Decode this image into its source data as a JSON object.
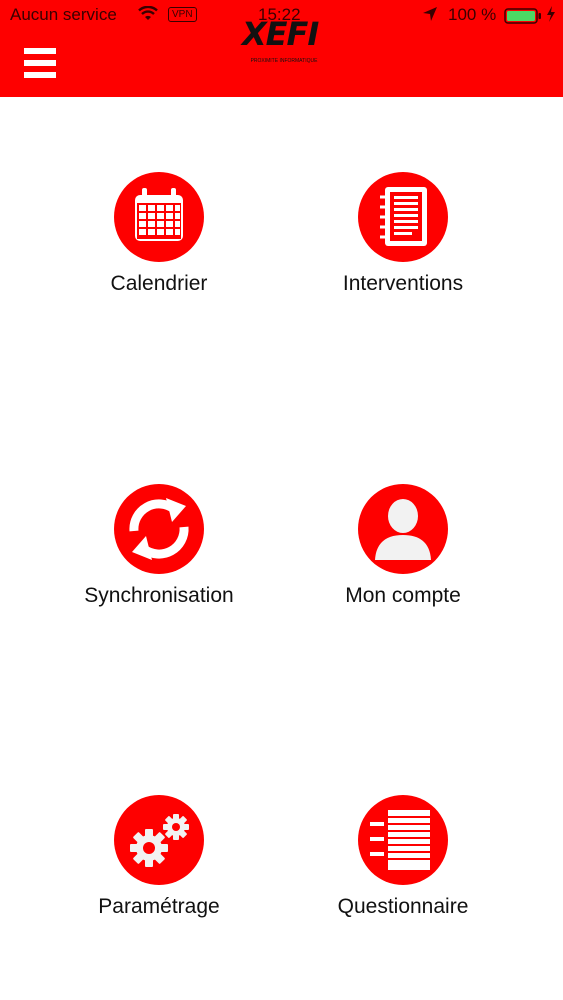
{
  "status_bar": {
    "carrier": "Aucun service",
    "vpn": "VPN",
    "time": "15:22",
    "battery_percent": "100 %",
    "icons": [
      "wifi-icon",
      "location-arrow-icon",
      "battery-icon",
      "charging-bolt-icon"
    ]
  },
  "header": {
    "logo_text": "XEFI",
    "logo_tagline": "PROXIMITE INFORMATIQUE",
    "menu_icon": "hamburger-menu-icon",
    "background": "#fe0000"
  },
  "tiles": [
    {
      "label": "Calendrier",
      "icon": "calendar-icon"
    },
    {
      "label": "Interventions",
      "icon": "notebook-icon"
    },
    {
      "label": "Synchronisation",
      "icon": "sync-icon"
    },
    {
      "label": "Mon compte",
      "icon": "user-icon"
    },
    {
      "label": "Paramétrage",
      "icon": "gears-icon"
    },
    {
      "label": "Questionnaire",
      "icon": "questionnaire-icon"
    }
  ],
  "colors": {
    "accent": "#fe0000",
    "text": "#111111"
  }
}
